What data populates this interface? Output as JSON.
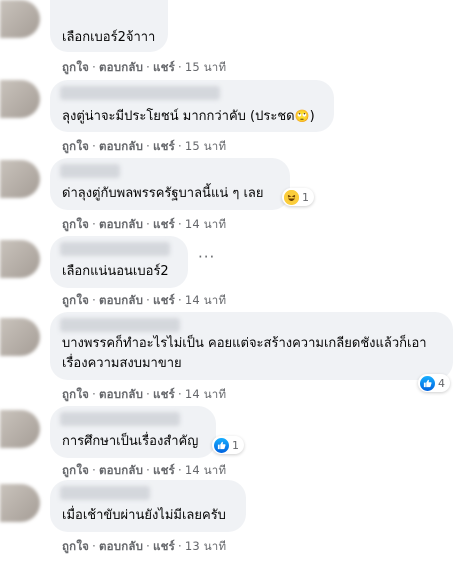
{
  "comments": [
    {
      "text": "เลือกเบอร์2จ้าาา",
      "time": "15 นาที",
      "reaction": null
    },
    {
      "text": "ลุงตู่น่าจะมีประโยชน์ มากกว่าคับ (ประชด",
      "emoji": "🙄",
      "emoji_suffix": ")",
      "time": "15 นาที",
      "reaction": null
    },
    {
      "text": "ด่าลุงตู่กับพลพรรครัฐบาลนี้แน่ ๆ เลย",
      "time": "14 นาที",
      "reaction": {
        "type": "haha",
        "count": "1"
      }
    },
    {
      "text": "เลือกแน่นอนเบอร์2",
      "time": "14 นาที",
      "reaction": null,
      "more": "···"
    },
    {
      "text": "บางพรรคก็ทำอะไรไม่เป็น คอยแต่จะสร้างความเกลียดชังแล้วก็เอาเรื่องความสงบมาขาย",
      "time": "14 นาที",
      "reaction": {
        "type": "like",
        "count": "4"
      }
    },
    {
      "text": "การศึกษาเป็นเรื่องสำคัญ",
      "time": "14 นาที",
      "reaction": {
        "type": "like",
        "count": "1"
      }
    },
    {
      "text": "เมื่อเช้าขับผ่านยังไม่มีเลยครับ",
      "time": "13 นาที",
      "reaction": null
    }
  ],
  "actions": {
    "like": "ถูกใจ",
    "reply": "ตอบกลับ",
    "share": "แชร์",
    "separator": "·"
  },
  "colors": {
    "bubble": "#f0f2f5",
    "meta": "#65676b",
    "like": "#0866ff",
    "haha": "#fbcd3b"
  }
}
